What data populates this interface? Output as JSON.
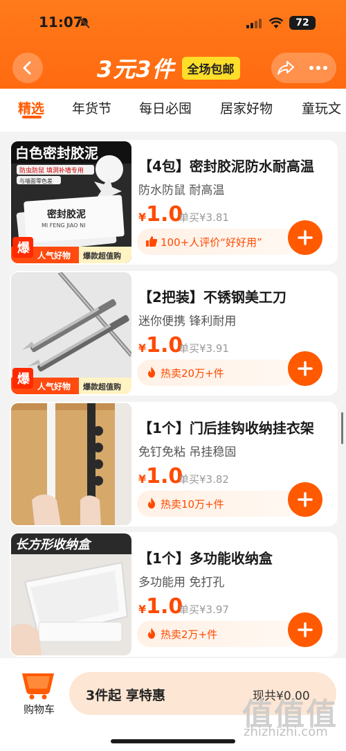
{
  "status": {
    "time": "11:07",
    "battery": "72"
  },
  "header": {
    "title": "3元3件",
    "tag": "全场包邮"
  },
  "tabs": [
    "精选",
    "年货节",
    "每日必囤",
    "居家好物",
    "童玩文"
  ],
  "products": [
    {
      "title": "【4包】密封胶泥防水耐高温",
      "subtitle": "防水防鼠 耐高温",
      "currency": "¥",
      "price": "1.0",
      "original": "单买¥3.81",
      "promo": "100+人评价“好好用”",
      "promo_icon": "thumbs-up-icon",
      "image": {
        "header": "白色密封胶泥",
        "tag1": "防虫防鼠 填洞补墙专用",
        "tag2": "与墙面零色差",
        "pack": "密封胶泥",
        "pack_pinyin": "MI FENG JIAO NI",
        "badge_big": "爆",
        "badge_left": "人气好物",
        "badge_right": "爆款超值购"
      }
    },
    {
      "title": "【2把装】不锈钢美工刀",
      "subtitle": "迷你便携 锋利耐用",
      "currency": "¥",
      "price": "1.0",
      "original": "单买¥3.91",
      "promo": "热卖20万+件",
      "promo_icon": "flame-icon",
      "image": {
        "badge_big": "爆",
        "badge_left": "人气好物",
        "badge_right": "爆款超值购"
      }
    },
    {
      "title": "【1个】门后挂钩收纳挂衣架",
      "subtitle": "免钉免粘 吊挂稳固",
      "currency": "¥",
      "price": "1.0",
      "original": "单买¥3.82",
      "promo": "热卖10万+件",
      "promo_icon": "flame-icon"
    },
    {
      "title": "【1个】多功能收纳盒",
      "subtitle": "多功能用 免打孔",
      "currency": "¥",
      "price": "1.0",
      "original": "单买¥3.97",
      "promo": "热卖2万+件",
      "promo_icon": "flame-icon",
      "image": {
        "header": "长方形收纳盒"
      }
    }
  ],
  "bottom": {
    "cart_label": "购物车",
    "cta_label": "3件起 享特惠",
    "total": "现共¥0.00"
  },
  "watermark": {
    "cn": "值值值",
    "en": "zhizhizhi.com"
  },
  "colors": {
    "accent": "#ff5a00",
    "header": "#ff6a10",
    "tag": "#ffde2a",
    "cta_bg": "#fde6d3"
  }
}
